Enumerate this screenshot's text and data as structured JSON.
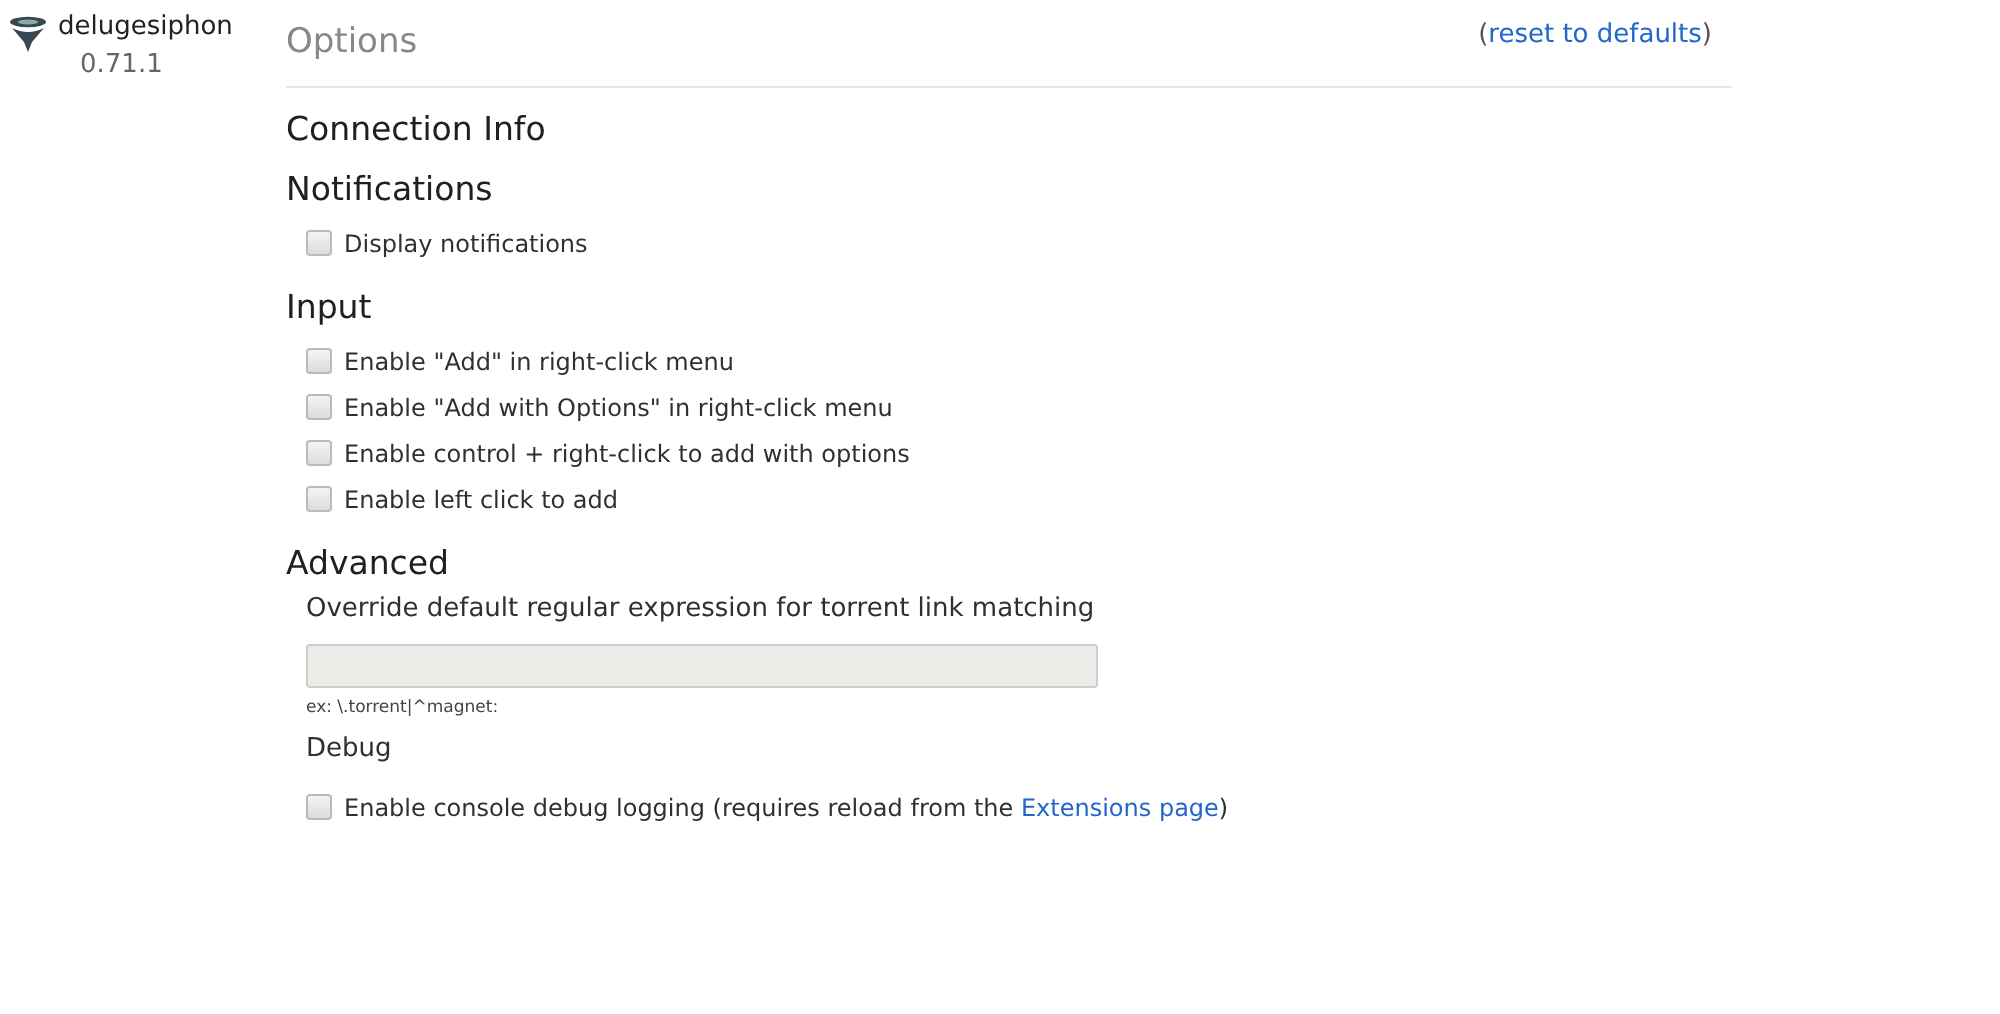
{
  "sidebar": {
    "name": "delugesiphon",
    "version": "0.71.1"
  },
  "header": {
    "title": "Options",
    "reset": {
      "open": "(",
      "label": "reset to defaults",
      "close": ")"
    }
  },
  "sections": [
    {
      "title": "Connection Info"
    },
    {
      "title": "Notifications",
      "items": [
        {
          "kind": "checkbox",
          "label": "Display notifications",
          "checked": false
        }
      ]
    },
    {
      "title": "Input",
      "items": [
        {
          "kind": "checkbox",
          "label": "Enable \"Add\" in right-click menu",
          "checked": false
        },
        {
          "kind": "checkbox",
          "label": "Enable \"Add with Options\" in right-click menu",
          "checked": false
        },
        {
          "kind": "checkbox",
          "label": "Enable control + right-click to add with options",
          "checked": false
        },
        {
          "kind": "checkbox",
          "label": "Enable left click to add",
          "checked": false
        }
      ]
    },
    {
      "title": "Advanced",
      "items": [
        {
          "kind": "subheading",
          "label": "Override default regular expression for torrent link matching"
        },
        {
          "kind": "textfield",
          "hint": "ex: \\.torrent|^magnet:"
        },
        {
          "kind": "subheading",
          "label": "Debug"
        },
        {
          "kind": "checkbox",
          "label": "Enable console debug logging (requires reload from the ",
          "link": "Extensions page",
          "after": ")",
          "checked": false
        }
      ]
    }
  ]
}
